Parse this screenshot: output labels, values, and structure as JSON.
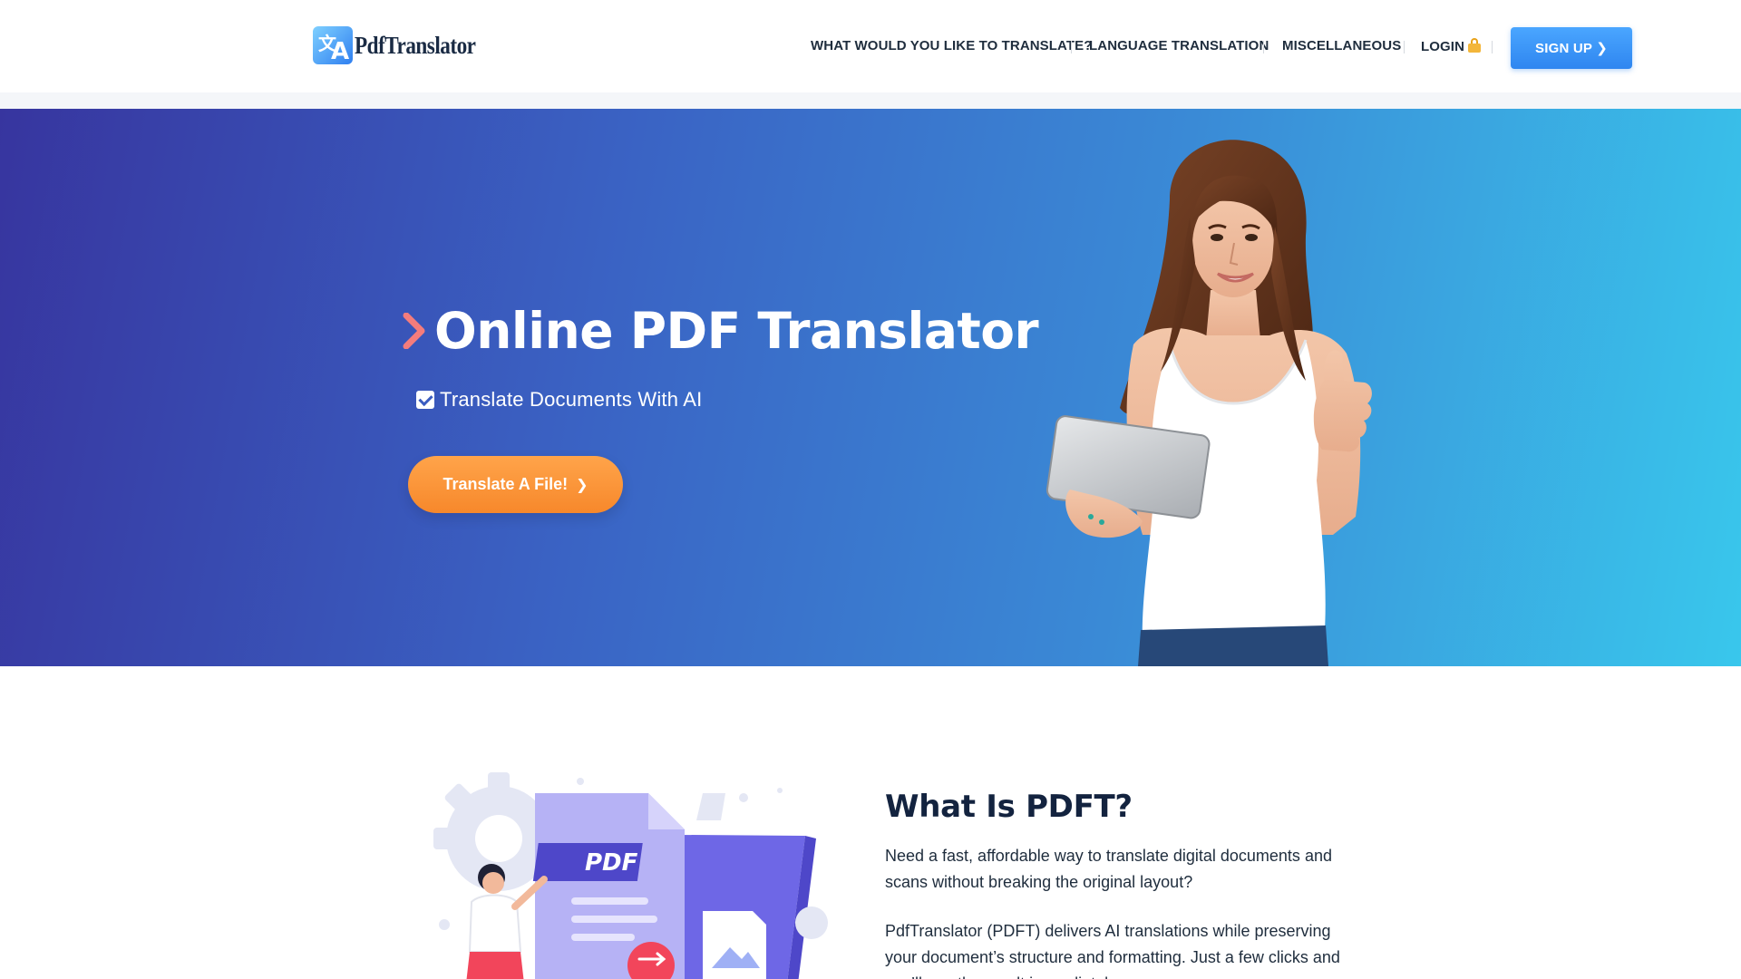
{
  "header": {
    "logo_text": "PdfTranslator",
    "logo_icon": "translate-icon",
    "nav": [
      {
        "label": "WHAT WOULD YOU LIKE TO TRANSLATE?"
      },
      {
        "label": "LANGUAGE TRANSLATION"
      },
      {
        "label": "MISCELLANEOUS"
      },
      {
        "label": "LOGIN"
      }
    ],
    "login_icon": "lock-icon",
    "signup_label": "SIGN UP ❯"
  },
  "hero": {
    "title": "Online PDF Translator",
    "subtitle": "Translate Documents With AI",
    "cta_label": "Translate A File!",
    "cta_arrow": "❯",
    "image": "woman-with-tablet-thumbs-up",
    "colors": {
      "gradient_start": "#37359f",
      "gradient_end": "#39c7ec",
      "cta": "#f7882b",
      "chevron": "#f47c7c"
    }
  },
  "about": {
    "title": "What Is PDFT?",
    "paragraph_1": "Need a fast, affordable way to translate digital documents and scans without breaking the original layout?",
    "paragraph_2": "PdfTranslator (PDFT) delivers AI translations while preserving your document’s structure and formatting. Just a few clicks and you’ll see the result immediately.",
    "illustration_label": "PDF",
    "illustration": "pdf-translation-illustration"
  },
  "colors": {
    "signup": "#2f86f0",
    "text_dark": "#13233f"
  }
}
